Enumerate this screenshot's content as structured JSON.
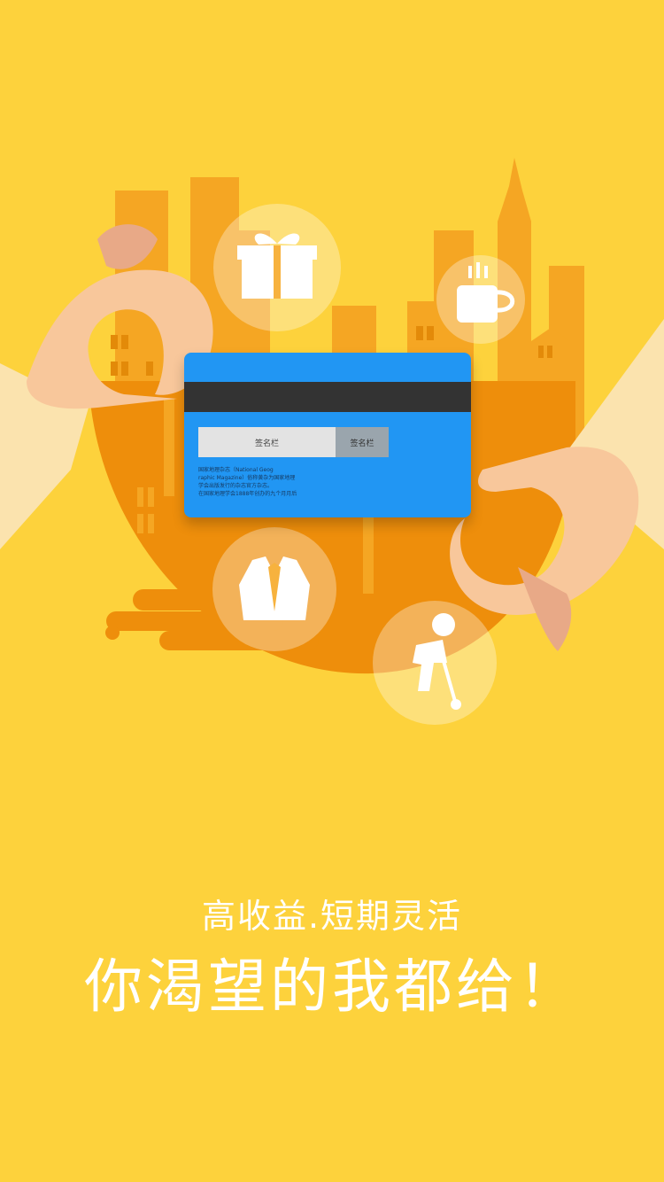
{
  "card": {
    "signature_label": "签名栏",
    "cvv_label": "签名栏",
    "fine_print": "国家地理杂志（National Geog\nraphic Magazine）俗称黄杂为国家地理\n学会出版发行的杂志官方杂志。\n在国家地理学会1888年创办的九个月月后"
  },
  "icons": [
    "gift-icon",
    "coffee-cup-icon",
    "suit-icon",
    "golf-icon"
  ],
  "tagline": {
    "subtitle": "高收益.短期灵活",
    "headline": "你渴望的我都给！"
  },
  "colors": {
    "background": "#FDD23C",
    "orange": "#EE8E0B",
    "building": "#F6A623",
    "card_blue": "#2196F3",
    "skin": "#F8C79B"
  }
}
